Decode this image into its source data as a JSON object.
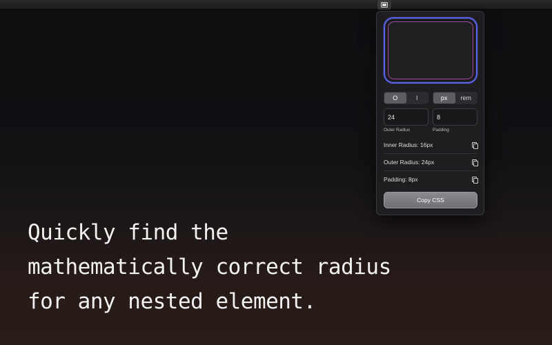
{
  "menubar": {
    "icon": "radius-app-icon"
  },
  "popover": {
    "unit_mode": {
      "options": [
        "O",
        "I"
      ],
      "selected": "O"
    },
    "unit_type": {
      "options": [
        "px",
        "rem"
      ],
      "selected": "px"
    },
    "outer_radius": {
      "value": "24",
      "label": "Outer Radius"
    },
    "padding": {
      "value": "8",
      "label": "Padding"
    },
    "results": [
      {
        "label": "Inner Radius: 16px",
        "icon": "copy-icon"
      },
      {
        "label": "Outer Radius: 24px",
        "icon": "copy-icon"
      },
      {
        "label": "Padding: 8px",
        "icon": "copy-icon"
      }
    ],
    "copy_css_label": "Copy CSS",
    "preview_colors": {
      "outer": "#5b62e8",
      "inner": "#a04c9e"
    }
  },
  "tagline": {
    "lines": [
      "Quickly find the",
      "mathematically correct radius",
      "for any nested element."
    ]
  }
}
